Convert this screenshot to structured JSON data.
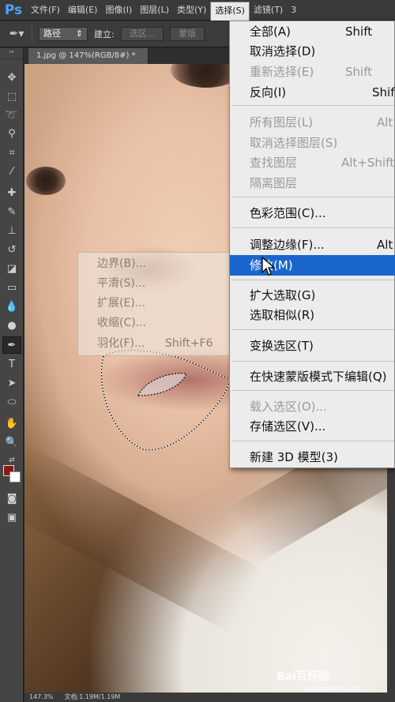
{
  "app": {
    "logo": "Ps"
  },
  "menubar": {
    "items": [
      "文件(F)",
      "编辑(E)",
      "图像(I)",
      "图层(L)",
      "类型(Y)",
      "选择(S)",
      "滤镜(T)",
      "3"
    ]
  },
  "options": {
    "mode_select": "路径",
    "build_label": "建立:",
    "selection_btn": "选区...",
    "mask_btn": "蒙版"
  },
  "document": {
    "tab_title": "1.jpg @ 147%(RGB/8#) *"
  },
  "select_menu": {
    "items": [
      {
        "label": "全部(A)",
        "shortcut": "Shift",
        "enabled": true
      },
      {
        "label": "取消选择(D)",
        "shortcut": "",
        "enabled": true
      },
      {
        "label": "重新选择(E)",
        "shortcut": "Shift",
        "enabled": false
      },
      {
        "label": "反向(I)",
        "shortcut": "Shif",
        "enabled": true
      },
      {
        "label": "所有图层(L)",
        "shortcut": "Alt",
        "enabled": false
      },
      {
        "label": "取消选择图层(S)",
        "shortcut": "",
        "enabled": false
      },
      {
        "label": "查找图层",
        "shortcut": "Alt+Shift",
        "enabled": false
      },
      {
        "label": "隔离图层",
        "shortcut": "",
        "enabled": false
      },
      {
        "label": "色彩范围(C)...",
        "shortcut": "",
        "enabled": true
      },
      {
        "label": "调整边缘(F)...",
        "shortcut": "Alt",
        "enabled": true
      },
      {
        "label": "修改(M)",
        "shortcut": "",
        "enabled": true,
        "highlighted": true
      },
      {
        "label": "扩大选取(G)",
        "shortcut": "",
        "enabled": true
      },
      {
        "label": "选取相似(R)",
        "shortcut": "",
        "enabled": true
      },
      {
        "label": "变换选区(T)",
        "shortcut": "",
        "enabled": true
      },
      {
        "label": "在快速蒙版模式下编辑(Q)",
        "shortcut": "",
        "enabled": true
      },
      {
        "label": "载入选区(O)...",
        "shortcut": "",
        "enabled": false
      },
      {
        "label": "存储选区(V)...",
        "shortcut": "",
        "enabled": true
      },
      {
        "label": "新建 3D 模型(3)",
        "shortcut": "",
        "enabled": true
      }
    ]
  },
  "modify_submenu": {
    "items": [
      {
        "label": "边界(B)...",
        "shortcut": ""
      },
      {
        "label": "平滑(S)...",
        "shortcut": ""
      },
      {
        "label": "扩展(E)...",
        "shortcut": ""
      },
      {
        "label": "收缩(C)...",
        "shortcut": ""
      },
      {
        "label": "羽化(F)...",
        "shortcut": "Shift+F6"
      }
    ]
  },
  "status": {
    "zoom": "147.3%",
    "doc": "文档:1.19M/1.19M"
  },
  "watermark": {
    "brand": "Bai百经验",
    "url": "jingyan.baidu.com"
  },
  "colors": {
    "foreground": "#8b1a10",
    "background": "#ffffff",
    "menu_highlight": "#1a66cc"
  },
  "icons": [
    "move-icon",
    "marquee-icon",
    "lasso-icon",
    "quick-select-icon",
    "crop-icon",
    "eyedropper-icon",
    "healing-brush-icon",
    "brush-icon",
    "clone-stamp-icon",
    "history-brush-icon",
    "eraser-icon",
    "gradient-icon",
    "blur-icon",
    "dodge-icon",
    "pen-icon",
    "type-icon",
    "path-select-icon",
    "ellipse-icon",
    "hand-icon",
    "zoom-icon"
  ]
}
